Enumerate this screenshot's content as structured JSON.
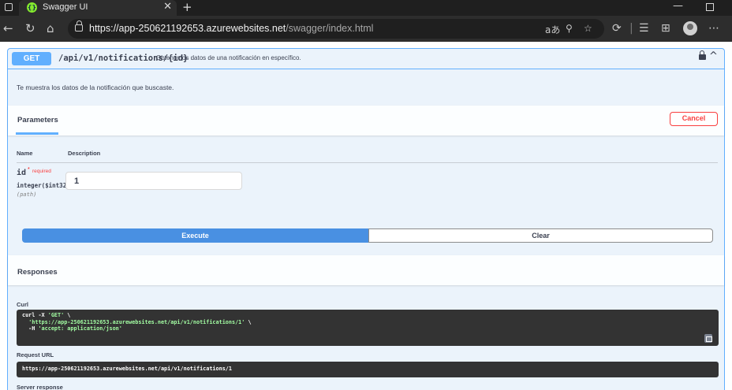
{
  "browser": {
    "tab_title": "Swagger UI",
    "tab_icon": "swagger-logo-icon",
    "favicon_glyph": "{}",
    "url_host": "https://app-250621192653.azurewebsites.net",
    "url_path": "/swagger/index.html",
    "translate_glyph": "aあ",
    "zoom_glyph": "⚲"
  },
  "operation": {
    "method": "GET",
    "path": "/api/v1/notifications/{id}",
    "summary": "Obtener los datos de una notificación en específico.",
    "description": "Te muestra los datos de la notificación que buscaste."
  },
  "parameters": {
    "title": "Parameters",
    "cancel_label": "Cancel",
    "col_name": "Name",
    "col_description": "Description",
    "items": [
      {
        "name": "id",
        "required_star": "*",
        "required_label": "required",
        "type": "integer($int32)",
        "location": "(path)",
        "value": "1"
      }
    ]
  },
  "actions": {
    "execute_label": "Execute",
    "clear_label": "Clear"
  },
  "responses": {
    "title": "Responses",
    "curl_label": "Curl",
    "curl_line1_cmd": "curl -X ",
    "curl_line1_str": "'GET'",
    "curl_line1_end": " \\",
    "curl_line2_str": "'https://app-250621192653.azurewebsites.net/api/v1/notifications/1'",
    "curl_line2_end": " \\",
    "curl_line3_cmd": "  -H ",
    "curl_line3_str": "'accept: application/json'",
    "request_url_label": "Request URL",
    "request_url": "https://app-250621192653.azurewebsites.net/api/v1/notifications/1",
    "server_response_label": "Server response"
  },
  "colors": {
    "get_blue": "#61affe",
    "execute_blue": "#4990e2",
    "cancel_red": "#f93e3e",
    "code_bg": "#333333"
  }
}
